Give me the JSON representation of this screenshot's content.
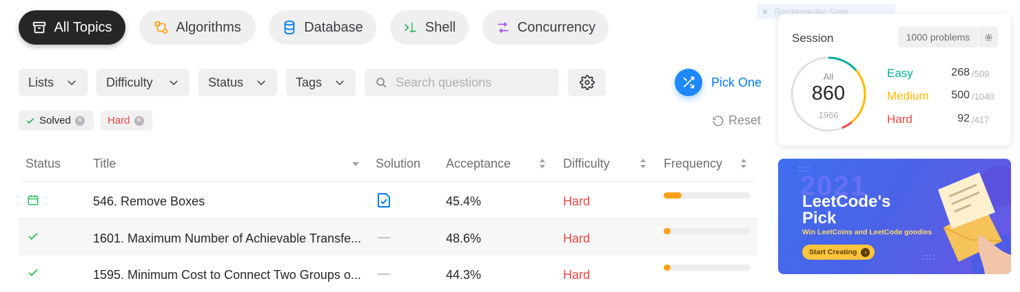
{
  "topics": [
    {
      "label": "All Topics",
      "icon": "archive-icon",
      "active": true
    },
    {
      "label": "Algorithms",
      "icon": "algorithm-icon"
    },
    {
      "label": "Database",
      "icon": "database-icon"
    },
    {
      "label": "Shell",
      "icon": "shell-icon"
    },
    {
      "label": "Concurrency",
      "icon": "concurrency-icon"
    }
  ],
  "filters": {
    "lists": "Lists",
    "difficulty": "Difficulty",
    "status": "Status",
    "tags": "Tags",
    "search_placeholder": "Search questions"
  },
  "pick_one": "Pick One",
  "active_tags": [
    {
      "label": "Solved",
      "color": "#262626"
    },
    {
      "label": "Hard",
      "color": "#ef4743"
    }
  ],
  "reset": "Reset",
  "table": {
    "headers": [
      "Status",
      "Title",
      "Solution",
      "Acceptance",
      "Difficulty",
      "Frequency"
    ],
    "rows": [
      {
        "status": "calendar",
        "title": "546. Remove Boxes",
        "solution": "article",
        "acceptance": "45.4%",
        "difficulty": "Hard",
        "frequency": 0.21
      },
      {
        "status": "solved",
        "title": "1601. Maximum Number of Achievable Transfe...",
        "solution": "none",
        "acceptance": "48.6%",
        "difficulty": "Hard",
        "frequency": 0.06
      },
      {
        "status": "solved",
        "title": "1595. Minimum Cost to Connect Two Groups o...",
        "solution": "none",
        "acceptance": "44.3%",
        "difficulty": "Hard",
        "frequency": 0.06
      }
    ]
  },
  "snip_label": "Rectangular Snip",
  "session": {
    "title": "Session",
    "problems_label": "1000 problems",
    "ring": {
      "label": "All",
      "solved": "860",
      "total": "1966"
    },
    "easy": {
      "label": "Easy",
      "solved": "268",
      "total": "/509",
      "color": "#00af9b"
    },
    "medium": {
      "label": "Medium",
      "solved": "500",
      "total": "/1040",
      "color": "#ffb800"
    },
    "hard": {
      "label": "Hard",
      "solved": "92",
      "total": "/417",
      "color": "#ef4743"
    }
  },
  "banner": {
    "year": "2021",
    "title_line1": "LeetCode's",
    "title_line2": "Pick",
    "subtitle": "Win LeetCoins and LeetCode goodies",
    "button": "Start Creating"
  }
}
